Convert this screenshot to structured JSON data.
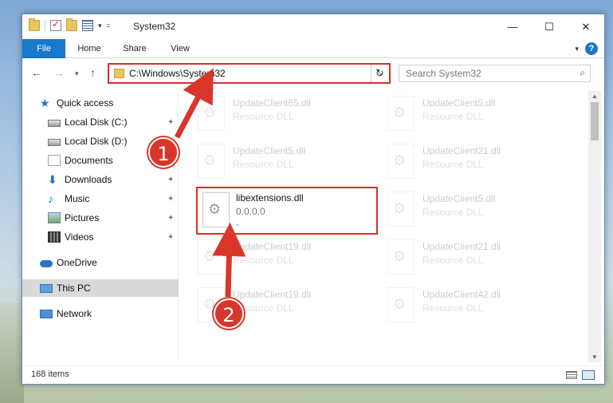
{
  "window": {
    "title": "System32",
    "buttons": {
      "minimize": "—",
      "maximize": "☐",
      "close": "✕"
    }
  },
  "ribbon": {
    "tabs": [
      "File",
      "Home",
      "Share",
      "View"
    ],
    "help": "?"
  },
  "navigation": {
    "address": "C:\\Windows\\System32",
    "search_placeholder": "Search System32"
  },
  "sidebar": {
    "items": [
      {
        "label": "Quick access",
        "icon": "star-icon",
        "pinned": false
      },
      {
        "label": "Local Disk (C:)",
        "icon": "disk-icon",
        "pinned": true
      },
      {
        "label": "Local Disk (D:)",
        "icon": "disk-icon",
        "pinned": false
      },
      {
        "label": "Documents",
        "icon": "documents-icon",
        "pinned": true
      },
      {
        "label": "Downloads",
        "icon": "download-icon",
        "pinned": true
      },
      {
        "label": "Music",
        "icon": "music-icon",
        "pinned": true
      },
      {
        "label": "Pictures",
        "icon": "pictures-icon",
        "pinned": true
      },
      {
        "label": "Videos",
        "icon": "videos-icon",
        "pinned": true
      },
      {
        "label": "OneDrive",
        "icon": "cloud-icon",
        "pinned": false
      },
      {
        "label": "This PC",
        "icon": "computer-icon",
        "pinned": false,
        "selected": true
      },
      {
        "label": "Network",
        "icon": "network-icon",
        "pinned": false
      }
    ]
  },
  "files": {
    "left_column": [
      {
        "name": "UpdateClient65.dll",
        "type": "Resource DLL"
      },
      {
        "name": "UpdateClient5.dll",
        "type": "Resource DLL"
      },
      {
        "name": "libextensions.dll",
        "type": "0.0.0.0",
        "extra": "-"
      },
      {
        "name": "UpdateClient19.dll",
        "type": "Resource DLL"
      },
      {
        "name": "UpdateClient19.dll",
        "type": "Resource DLL"
      }
    ],
    "right_column": [
      {
        "name": "UpdateClient5.dll",
        "type": "Resource DLL"
      },
      {
        "name": "UpdateClient21.dll",
        "type": "Resource DLL"
      },
      {
        "name": "UpdateClient5.dll",
        "type": "Resource DLL"
      },
      {
        "name": "UpdateClient21.dll",
        "type": "Resource DLL"
      },
      {
        "name": "UpdateClient42.dll",
        "type": "Resource DLL"
      }
    ]
  },
  "status": {
    "count": "168 items"
  },
  "annotations": {
    "step1": "1",
    "step2": "2",
    "color": "#d9362b"
  }
}
